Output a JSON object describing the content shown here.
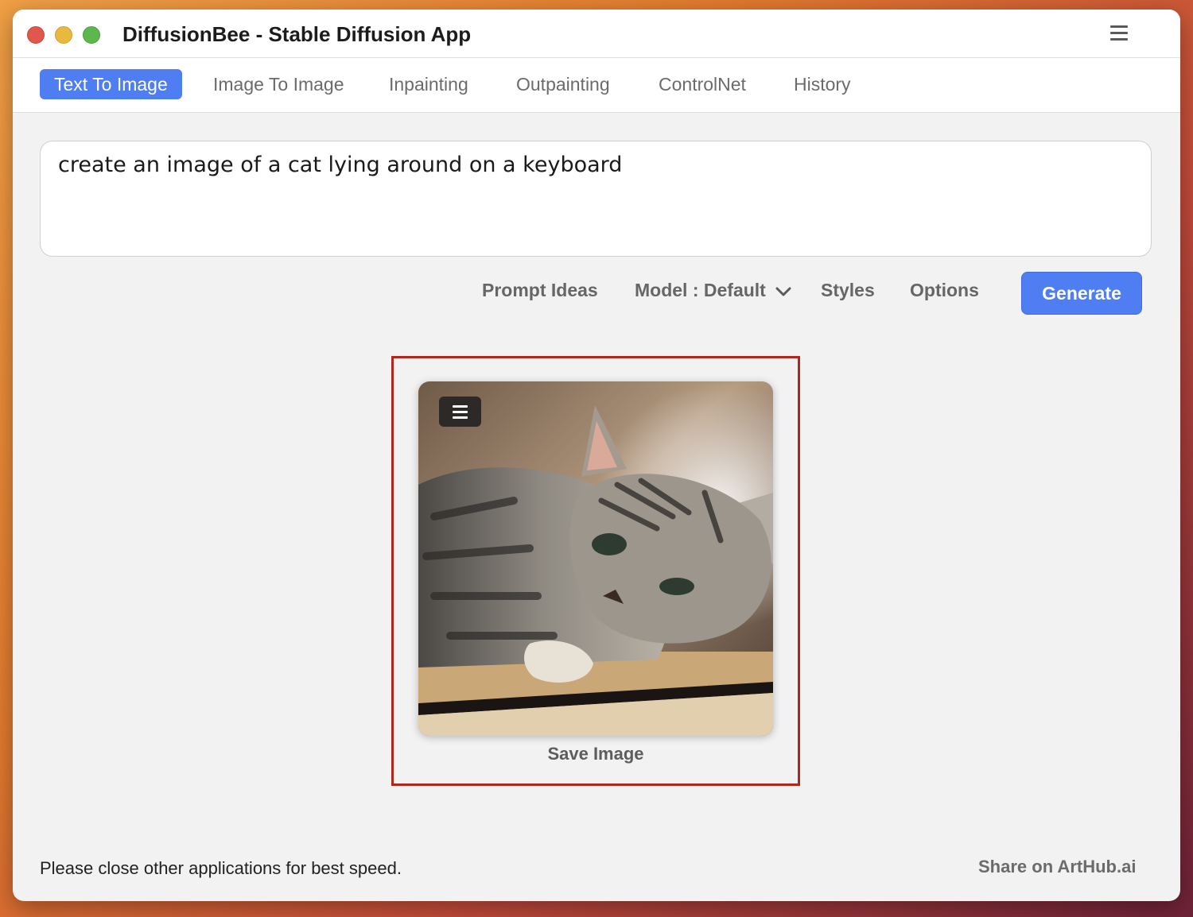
{
  "window": {
    "title": "DiffusionBee - Stable Diffusion App",
    "menu_icon": "hamburger-menu-icon"
  },
  "tabs": [
    {
      "label": "Text To Image",
      "active": true
    },
    {
      "label": "Image To Image",
      "active": false
    },
    {
      "label": "Inpainting",
      "active": false
    },
    {
      "label": "Outpainting",
      "active": false
    },
    {
      "label": "ControlNet",
      "active": false
    },
    {
      "label": "History",
      "active": false
    }
  ],
  "prompt": {
    "value": "create an image of a cat lying around on a keyboard"
  },
  "toolbar": {
    "prompt_ideas": "Prompt Ideas",
    "model": "Model : Default",
    "styles": "Styles",
    "options": "Options",
    "generate": "Generate"
  },
  "result": {
    "save_label": "Save Image",
    "menu_icon": "hamburger-menu-icon"
  },
  "footer": {
    "note": "Please close other applications for best speed.",
    "share": "Share on ArtHub.ai"
  },
  "colors": {
    "accent": "#4e7ef1",
    "highlight_frame": "#b0271c",
    "background": "#f2f2f2"
  }
}
